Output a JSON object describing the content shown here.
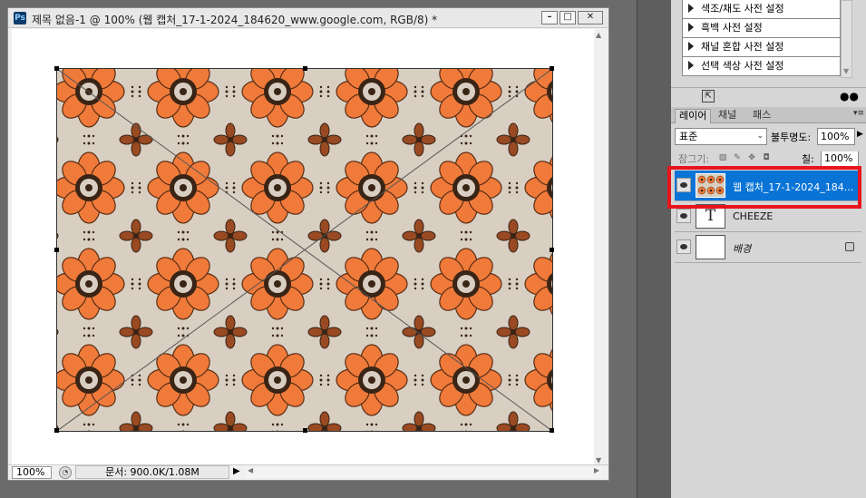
{
  "app": {
    "logo": "Ps"
  },
  "document": {
    "title": "제목 없음-1 @ 100% (웹 캡처_17-1-2024_184620_www.google.com, RGB/8) *",
    "buttons": {
      "minimize": "–",
      "restore": "□",
      "close": "✕"
    }
  },
  "status": {
    "zoom": "100%",
    "doc_info": "문서: 900.0K/1.08M",
    "arrow": "▶"
  },
  "presets": {
    "items": [
      {
        "label": "색조/채도 사전 설정"
      },
      {
        "label": "흑백 사전 설정"
      },
      {
        "label": "채널 혼합 사전 설정"
      },
      {
        "label": "선택 색상 사전 설정"
      }
    ]
  },
  "layers_panel": {
    "tabs": [
      {
        "label": "레이어",
        "active": true
      },
      {
        "label": "채널",
        "active": false
      },
      {
        "label": "패스",
        "active": false
      }
    ],
    "blend_mode": "표준",
    "opacity_label": "불투명도:",
    "opacity_value": "100%",
    "lock_label": "잠그기:",
    "fill_label": "칠:",
    "fill_value": "100%",
    "layers": [
      {
        "name": "웹 캡처_17-1-2024_184...",
        "type": "image",
        "selected": true,
        "visible": true
      },
      {
        "name": "CHEEZE",
        "type": "text",
        "selected": false,
        "visible": true,
        "thumb_glyph": "T"
      },
      {
        "name": "배경",
        "type": "background",
        "selected": false,
        "visible": true,
        "locked": true
      }
    ]
  },
  "colors": {
    "pattern_bg": "#d8cfc2",
    "pattern_orange": "#f07a3a",
    "pattern_dark": "#3a2415",
    "pattern_brown": "#9a4a22",
    "selection_blue": "#0a74d6",
    "highlight_red": "#e8141d"
  }
}
